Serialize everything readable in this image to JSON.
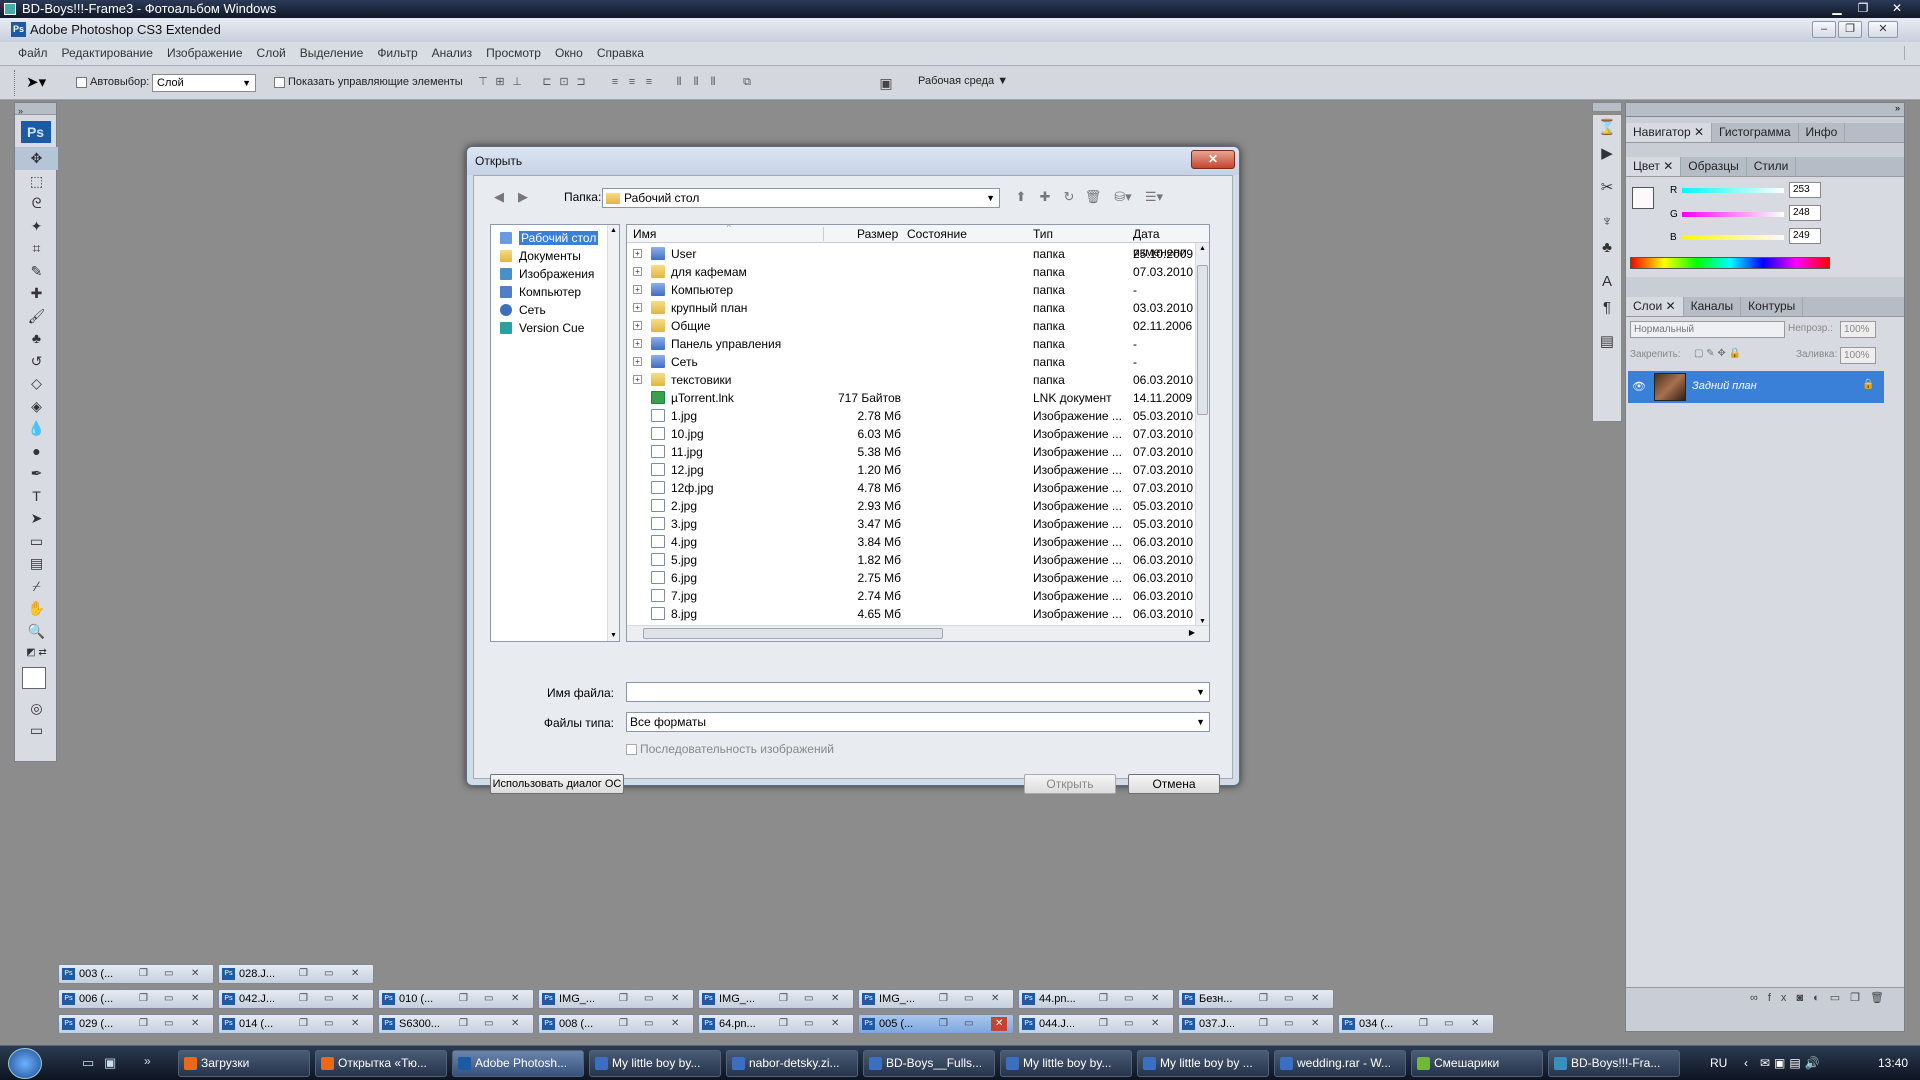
{
  "outer_window": {
    "title": "BD-Boys!!!-Frame3 - Фотоальбом Windows"
  },
  "app": {
    "title": "Adobe Photoshop CS3 Extended",
    "menu": [
      "Файл",
      "Редактирование",
      "Изображение",
      "Слой",
      "Выделение",
      "Фильтр",
      "Анализ",
      "Просмотр",
      "Окно",
      "Справка"
    ]
  },
  "options": {
    "autoselect_label": "Автовыбор:",
    "autoselect_value": "Слой",
    "show_controls_label": "Показать управляющие элементы",
    "workspace_label": "Рабочая среда"
  },
  "panels": {
    "nav_tabs": [
      "Навигатор",
      "Гистограмма",
      "Инфо"
    ],
    "color_tabs": [
      "Цвет",
      "Образцы",
      "Стили"
    ],
    "color": {
      "r_label": "R",
      "r": "253",
      "g_label": "G",
      "g": "248",
      "b_label": "B",
      "b": "249"
    },
    "layer_tabs": [
      "Слои",
      "Каналы",
      "Контуры"
    ],
    "layers": {
      "blend": "Нормальный",
      "opacity_label": "Непрозр.:",
      "opacity": "100%",
      "lock_label": "Закрепить:",
      "fill_label": "Заливка:",
      "fill": "100%",
      "background_layer": "Задний план"
    }
  },
  "dialog": {
    "title": "Открыть",
    "folder_label": "Папка:",
    "folder_value": "Рабочий стол",
    "places": [
      "Рабочий стол",
      "Документы",
      "Изображения",
      "Компьютер",
      "Сеть",
      "Version Cue"
    ],
    "columns": {
      "name": "Имя",
      "size": "Размер",
      "state": "Состояние",
      "type": "Тип",
      "date": "Дата изменени"
    },
    "files": [
      {
        "name": "User",
        "size": "",
        "type": "папка",
        "date": "25.10.2009",
        "kind": "sys",
        "expand": true
      },
      {
        "name": "для кафемам",
        "size": "",
        "type": "папка",
        "date": "07.03.2010",
        "kind": "folder",
        "expand": true
      },
      {
        "name": "Компьютер",
        "size": "",
        "type": "папка",
        "date": "-",
        "kind": "sys",
        "expand": true
      },
      {
        "name": "крупный план",
        "size": "",
        "type": "папка",
        "date": "03.03.2010",
        "kind": "folder",
        "expand": true
      },
      {
        "name": "Общие",
        "size": "",
        "type": "папка",
        "date": "02.11.2006",
        "kind": "folder",
        "expand": true
      },
      {
        "name": "Панель управления",
        "size": "",
        "type": "папка",
        "date": "-",
        "kind": "sys",
        "expand": true
      },
      {
        "name": "Сеть",
        "size": "",
        "type": "папка",
        "date": "-",
        "kind": "sys",
        "expand": true
      },
      {
        "name": "текстовики",
        "size": "",
        "type": "папка",
        "date": "06.03.2010",
        "kind": "folder",
        "expand": true
      },
      {
        "name": "µTorrent.lnk",
        "size": "717 Байтов",
        "type": "LNK документ",
        "date": "14.11.2009",
        "kind": "lnk",
        "expand": false
      },
      {
        "name": "1.jpg",
        "size": "2.78 Мб",
        "type": "Изображение ...",
        "date": "05.03.2010",
        "kind": "file",
        "expand": false
      },
      {
        "name": "10.jpg",
        "size": "6.03 Мб",
        "type": "Изображение ...",
        "date": "07.03.2010",
        "kind": "file",
        "expand": false
      },
      {
        "name": "11.jpg",
        "size": "5.38 Мб",
        "type": "Изображение ...",
        "date": "07.03.2010",
        "kind": "file",
        "expand": false
      },
      {
        "name": "12.jpg",
        "size": "1.20 Мб",
        "type": "Изображение ...",
        "date": "07.03.2010",
        "kind": "file",
        "expand": false
      },
      {
        "name": "12ф.jpg",
        "size": "4.78 Мб",
        "type": "Изображение ...",
        "date": "07.03.2010",
        "kind": "file",
        "expand": false
      },
      {
        "name": "2.jpg",
        "size": "2.93 Мб",
        "type": "Изображение ...",
        "date": "05.03.2010",
        "kind": "file",
        "expand": false
      },
      {
        "name": "3.jpg",
        "size": "3.47 Мб",
        "type": "Изображение ...",
        "date": "05.03.2010",
        "kind": "file",
        "expand": false
      },
      {
        "name": "4.jpg",
        "size": "3.84 Мб",
        "type": "Изображение ...",
        "date": "06.03.2010",
        "kind": "file",
        "expand": false
      },
      {
        "name": "5.jpg",
        "size": "1.82 Мб",
        "type": "Изображение ...",
        "date": "06.03.2010",
        "kind": "file",
        "expand": false
      },
      {
        "name": "6.jpg",
        "size": "2.75 Мб",
        "type": "Изображение ...",
        "date": "06.03.2010",
        "kind": "file",
        "expand": false
      },
      {
        "name": "7.jpg",
        "size": "2.74 Мб",
        "type": "Изображение ...",
        "date": "06.03.2010",
        "kind": "file",
        "expand": false
      },
      {
        "name": "8.jpg",
        "size": "4.65 Мб",
        "type": "Изображение ...",
        "date": "06.03.2010",
        "kind": "file",
        "expand": false
      }
    ],
    "filename_label": "Имя файла:",
    "filename_value": "",
    "filetype_label": "Файлы типа:",
    "filetype_value": "Все форматы",
    "sequence_label": "Последовательность изображений",
    "os_dialog_button": "Использовать диалог ОС",
    "open_button": "Открыть",
    "cancel_button": "Отмена"
  },
  "documents": [
    {
      "label": "003 (..."
    },
    {
      "label": "028.J..."
    },
    {
      "label": "006 (..."
    },
    {
      "label": "042.J..."
    },
    {
      "label": "010 (..."
    },
    {
      "label": "IMG_..."
    },
    {
      "label": "IMG_..."
    },
    {
      "label": "IMG_..."
    },
    {
      "label": "44.pn..."
    },
    {
      "label": "Безн..."
    },
    {
      "label": "029 (..."
    },
    {
      "label": "014 (..."
    },
    {
      "label": "S6300..."
    },
    {
      "label": "008 (..."
    },
    {
      "label": "64.pn..."
    },
    {
      "label": "005 (...",
      "active": true
    },
    {
      "label": "044.J..."
    },
    {
      "label": "037.J..."
    },
    {
      "label": "034 (..."
    }
  ],
  "taskbar": {
    "items": [
      {
        "label": "Загрузки",
        "color": "#e66a1a"
      },
      {
        "label": "Открытка «Тю...",
        "color": "#e66a1a"
      },
      {
        "label": "Adobe Photosh...",
        "color": "#1c5aa6",
        "active": true
      },
      {
        "label": "My little boy by...",
        "color": "#3a6fc1"
      },
      {
        "label": "nabor-detsky.zi...",
        "color": "#3a6fc1"
      },
      {
        "label": "BD-Boys__Fulls...",
        "color": "#3a6fc1"
      },
      {
        "label": "My little boy by...",
        "color": "#3a6fc1"
      },
      {
        "label": "My little boy by ...",
        "color": "#3a6fc1"
      },
      {
        "label": "wedding.rar - W...",
        "color": "#3a6fc1"
      },
      {
        "label": "Смешарики",
        "color": "#6fb83a"
      },
      {
        "label": "BD-Boys!!!-Fra...",
        "color": "#3a8fc1"
      }
    ],
    "lang": "RU",
    "time": "13:40"
  },
  "colors": {
    "accent": "#3a80d8",
    "ps_blue": "#1c5aa6",
    "close_red": "#c4452e"
  }
}
